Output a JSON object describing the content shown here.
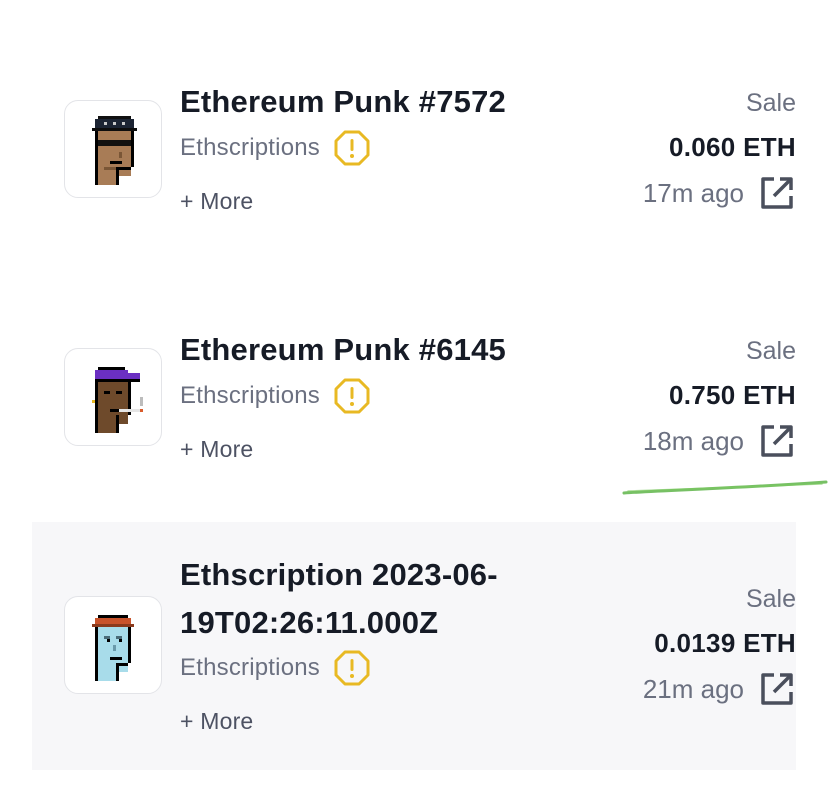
{
  "items": [
    {
      "title": "Ethereum Punk #7572",
      "title_line2": "",
      "collection": "Ethscriptions",
      "more": "+ More",
      "kind": "Sale",
      "price": "0.060 ETH",
      "time": "17m ago"
    },
    {
      "title": "Ethereum Punk #6145",
      "title_line2": "",
      "collection": "Ethscriptions",
      "more": "+ More",
      "kind": "Sale",
      "price": "0.750 ETH",
      "time": "18m ago"
    },
    {
      "title": "Ethscription 2023-06-",
      "title_line2": "19T02:26:11.000Z",
      "collection": "Ethscriptions",
      "more": "+ More",
      "kind": "Sale",
      "price": "0.0139 ETH",
      "time": "21m ago"
    }
  ],
  "colors": {
    "warning": "#e8b923",
    "text_primary": "#161b26",
    "text_secondary": "#6b7080",
    "highlight_bg": "#f7f7f9",
    "annotation_green": "#5fb54a"
  },
  "icons": {
    "warning": "warning-octagon-icon",
    "external": "external-link-icon"
  }
}
